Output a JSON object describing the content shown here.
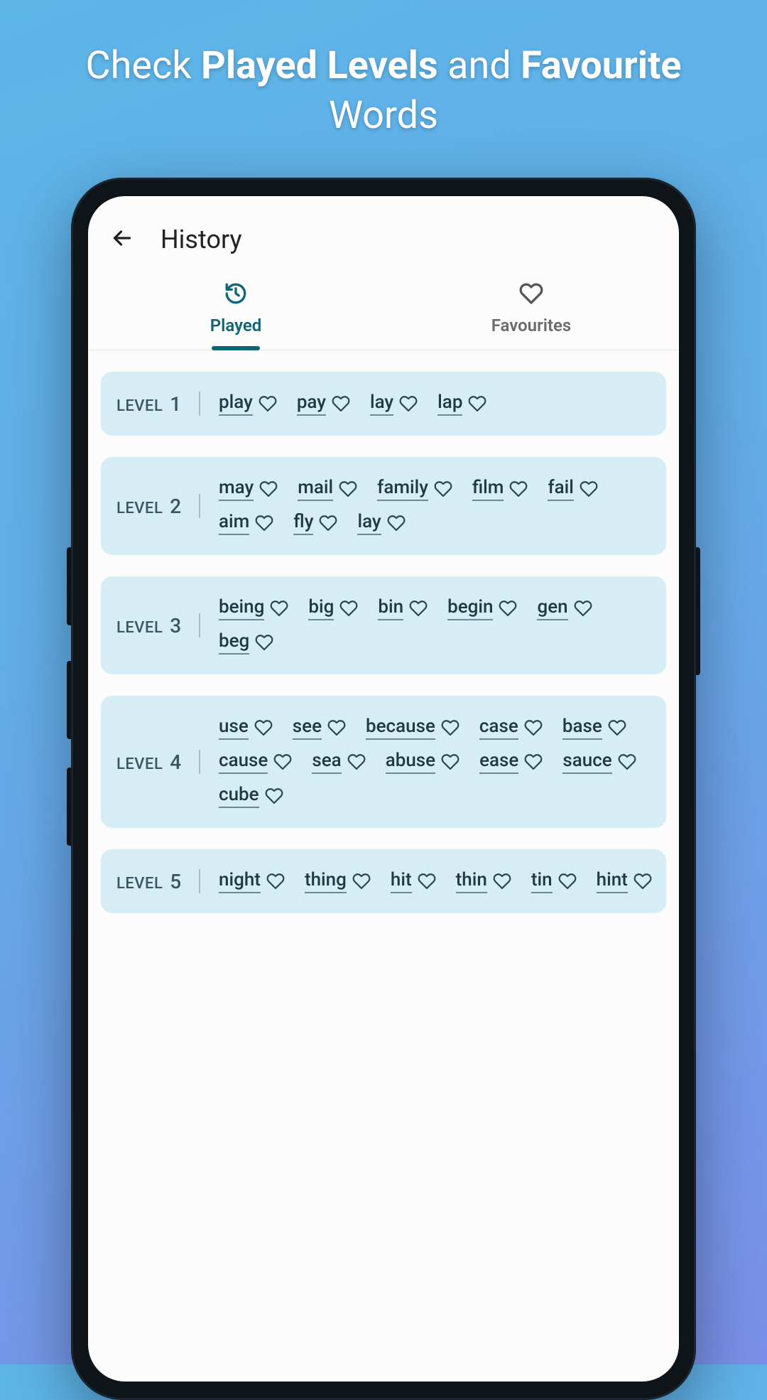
{
  "promo": {
    "part1": "Check ",
    "bold1": "Played Levels",
    "part2": " and ",
    "bold2": "Favourite",
    "part3": " Words"
  },
  "appbar": {
    "title": "History"
  },
  "tabs": {
    "played": "Played",
    "favourites": "Favourites"
  },
  "level_prefix": "LEVEL",
  "levels": [
    {
      "n": "1",
      "words": [
        "play",
        "pay",
        "lay",
        "lap"
      ]
    },
    {
      "n": "2",
      "words": [
        "may",
        "mail",
        "family",
        "film",
        "fail",
        "aim",
        "fly",
        "lay"
      ]
    },
    {
      "n": "3",
      "words": [
        "being",
        "big",
        "bin",
        "begin",
        "gen",
        "beg"
      ]
    },
    {
      "n": "4",
      "words": [
        "use",
        "see",
        "because",
        "case",
        "base",
        "cause",
        "sea",
        "abuse",
        "ease",
        "sauce",
        "cube"
      ]
    },
    {
      "n": "5",
      "words": [
        "night",
        "thing",
        "hit",
        "thin",
        "tin",
        "hint"
      ]
    }
  ],
  "colors": {
    "accent": "#0f6478",
    "card": "#d6edf6"
  }
}
